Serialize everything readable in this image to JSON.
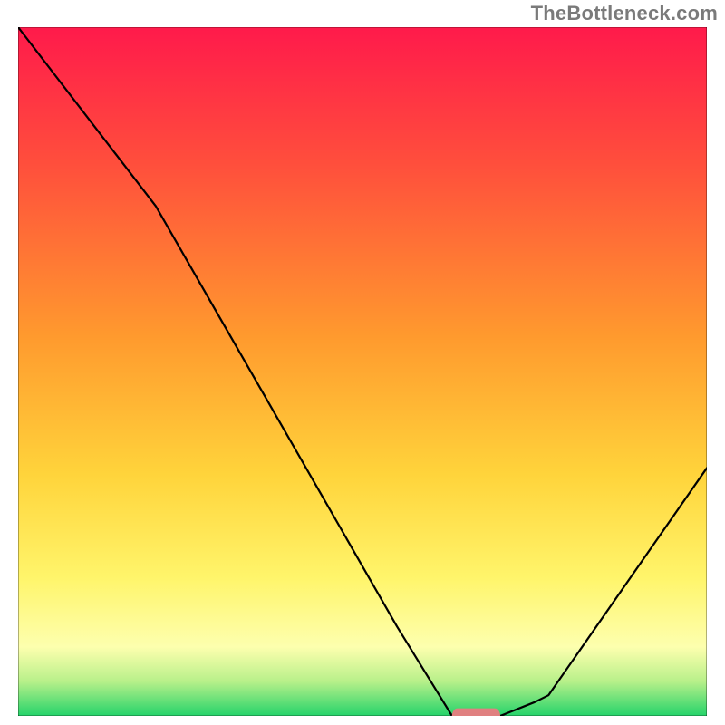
{
  "watermark": "TheBottleneck.com",
  "chart_data": {
    "type": "line",
    "title": "",
    "xlabel": "",
    "ylabel": "",
    "xlim": [
      0,
      100
    ],
    "ylim": [
      0,
      100
    ],
    "grid": false,
    "legend": false,
    "series": [
      {
        "name": "bottleneck-curve",
        "x": [
          0,
          20,
          55,
          63,
          70,
          75,
          77,
          100
        ],
        "values": [
          100,
          74,
          13,
          0,
          0,
          2,
          3,
          36
        ]
      }
    ],
    "marker": {
      "name": "optimal-marker",
      "x_start": 63,
      "x_end": 70,
      "y": 0,
      "color": "#e08080"
    },
    "background_gradient": {
      "stops": [
        {
          "offset": 0.0,
          "color": "#ff1a4b"
        },
        {
          "offset": 0.2,
          "color": "#ff4f3c"
        },
        {
          "offset": 0.45,
          "color": "#ff9a2e"
        },
        {
          "offset": 0.65,
          "color": "#ffd43b"
        },
        {
          "offset": 0.8,
          "color": "#fff56b"
        },
        {
          "offset": 0.9,
          "color": "#fdffae"
        },
        {
          "offset": 0.95,
          "color": "#b8f08a"
        },
        {
          "offset": 1.0,
          "color": "#24d36a"
        }
      ]
    },
    "frame_color": "#000000",
    "curve_color": "#000000"
  }
}
